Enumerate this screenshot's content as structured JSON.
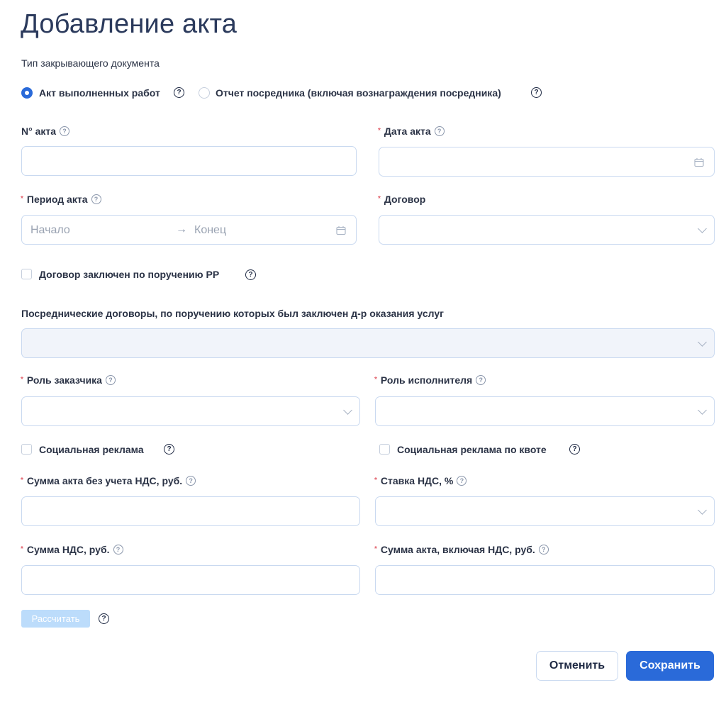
{
  "page": {
    "title": "Добавление акта"
  },
  "doc_type": {
    "label": "Тип закрывающего документа",
    "options": [
      {
        "label": "Акт выполненных работ",
        "selected": true
      },
      {
        "label": "Отчет посредника (включая вознаграждения посредника)",
        "selected": false
      }
    ]
  },
  "fields": {
    "act_number": {
      "label": "N° акта",
      "required": false,
      "value": ""
    },
    "act_date": {
      "label": "Дата акта",
      "required": true,
      "value": ""
    },
    "act_period": {
      "label": "Период акта",
      "required": true,
      "start_placeholder": "Начало",
      "end_placeholder": "Конец",
      "arrow": "→"
    },
    "contract": {
      "label": "Договор",
      "required": true,
      "value": ""
    },
    "contract_rr": {
      "label": "Договор заключен по поручению РР",
      "checked": false
    },
    "intermediary_contracts": {
      "label": "Посреднические договоры, по поручению которых был заключен д-р оказания услуг",
      "value": ""
    },
    "customer_role": {
      "label": "Роль заказчика",
      "required": true,
      "value": ""
    },
    "executor_role": {
      "label": "Роль исполнителя",
      "required": true,
      "value": ""
    },
    "social_ad": {
      "label": "Социальная реклама",
      "checked": false
    },
    "social_ad_quota": {
      "label": "Социальная реклама по квоте",
      "checked": false
    },
    "amount_no_vat": {
      "label": "Сумма акта без учета НДС, руб.",
      "required": true,
      "value": ""
    },
    "vat_rate": {
      "label": "Ставка НДС, %",
      "required": true,
      "value": ""
    },
    "vat_amount": {
      "label": "Сумма НДС, руб.",
      "required": true,
      "value": ""
    },
    "amount_with_vat": {
      "label": "Сумма акта, включая НДС, руб.",
      "required": true,
      "value": ""
    }
  },
  "symbols": {
    "required": "*",
    "help": "?"
  },
  "buttons": {
    "calculate": "Рассчитать",
    "cancel": "Отменить",
    "save": "Сохранить"
  },
  "colors": {
    "primary": "#2a6ad9",
    "required": "#e2626d",
    "disabled_button": "#bcdcfb",
    "input_border": "#c9d9f0"
  }
}
